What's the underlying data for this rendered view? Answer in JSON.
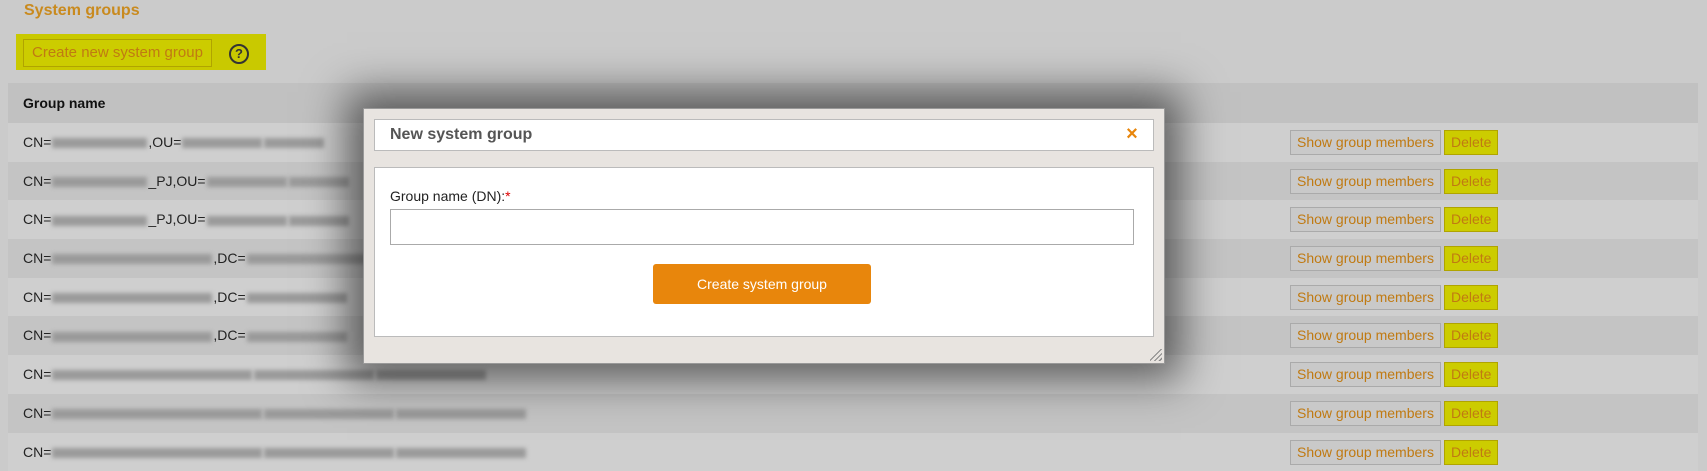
{
  "page": {
    "title": "System groups",
    "create_button": "Create new system group",
    "help_icon": "?"
  },
  "table": {
    "header": "Group name",
    "rows": [
      {
        "prefix": "CN=",
        "suffix": ",OU=",
        "actions": [
          "Show group members",
          "Delete"
        ]
      },
      {
        "prefix": "CN=",
        "suffix": "_PJ,OU=",
        "actions": [
          "Show group members",
          "Delete"
        ]
      },
      {
        "prefix": "CN=",
        "suffix": "_PJ,OU=",
        "actions": [
          "Show group members",
          "Delete"
        ]
      },
      {
        "prefix": "CN=",
        "suffix": ",DC=",
        "actions": [
          "Show group members",
          "Delete"
        ]
      },
      {
        "prefix": "CN=",
        "suffix": ",DC=",
        "actions": [
          "Show group members",
          "Delete"
        ]
      },
      {
        "prefix": "CN=",
        "suffix": ",DC=",
        "actions": [
          "Show group members",
          "Delete"
        ]
      },
      {
        "prefix": "CN=",
        "suffix": "",
        "actions": [
          "Show group members",
          "Delete"
        ]
      },
      {
        "prefix": "CN=",
        "suffix": "",
        "actions": [
          "Show group members",
          "Delete"
        ]
      },
      {
        "prefix": "CN=",
        "suffix": "",
        "actions": [
          "Show group members",
          "Delete"
        ]
      }
    ]
  },
  "dialog": {
    "title": "New system group",
    "close_icon": "×",
    "field_label": "Group name (DN):",
    "required_marker": "*",
    "field_value": "",
    "submit_label": "Create system group"
  },
  "colors": {
    "accent": "#e8860c",
    "highlight": "#c9c900",
    "link_text": "#c07a12"
  }
}
